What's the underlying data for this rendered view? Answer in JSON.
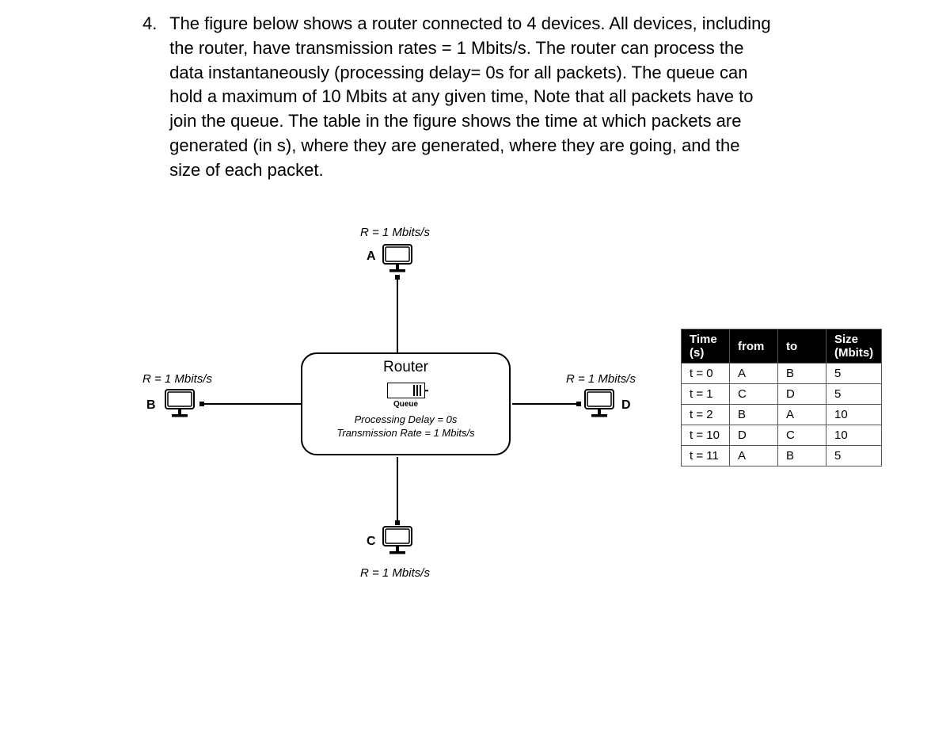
{
  "problem": {
    "number": "4.",
    "text": "The figure below shows a router connected to 4 devices. All devices, including the router, have transmission rates = 1 Mbits/s. The router can process the data instantaneously (processing delay= 0s for all packets). The queue can hold a maximum of 10 Mbits at any given  time, Note that all packets have to join the queue. The table in the figure shows the time at which packets are generated (in s), where they are generated, where they are going, and the size of each packet."
  },
  "diagram": {
    "rate": "R = 1 Mbits/s",
    "deviceA": "A",
    "deviceB": "B",
    "deviceC": "C",
    "deviceD": "D",
    "router": {
      "title": "Router",
      "queue": "Queue",
      "sub1": "Processing Delay = 0s",
      "sub2": "Transmission Rate = 1 Mbits/s"
    }
  },
  "table": {
    "headers": {
      "time": "Time (s)",
      "from": "from",
      "to": "to",
      "size": "Size (Mbits)"
    },
    "rows": [
      {
        "time": "t = 0",
        "from": "A",
        "to": "B",
        "size": "5"
      },
      {
        "time": "t = 1",
        "from": "C",
        "to": "D",
        "size": "5"
      },
      {
        "time": "t = 2",
        "from": "B",
        "to": "A",
        "size": "10"
      },
      {
        "time": "t = 10",
        "from": "D",
        "to": "C",
        "size": "10"
      },
      {
        "time": "t = 11",
        "from": "A",
        "to": "B",
        "size": "5"
      }
    ]
  }
}
